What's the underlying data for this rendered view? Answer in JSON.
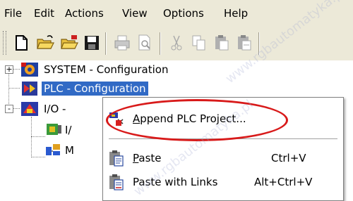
{
  "menubar": {
    "items": [
      "File",
      "Edit",
      "Actions",
      "View",
      "Options",
      "Help"
    ]
  },
  "toolbar": {
    "buttons": [
      "new-file-icon",
      "open-folder-icon",
      "open-recent-icon",
      "save-icon",
      "print-icon",
      "print-preview-icon",
      "cut-icon",
      "copy-icon",
      "paste-icon",
      "paste-links-icon"
    ]
  },
  "tree": {
    "nodes": [
      {
        "label": "SYSTEM - Configuration",
        "expander": "+"
      },
      {
        "label": "PLC - Configuration",
        "selected": true
      },
      {
        "label": "I/O - ",
        "expander": "-"
      },
      {
        "label": "I/"
      },
      {
        "label": "M"
      }
    ]
  },
  "context_menu": {
    "items": [
      {
        "label": "Append PLC Project...",
        "mnemonic": "A",
        "shortcut": ""
      },
      {
        "label": "Paste",
        "mnemonic": "P",
        "shortcut": "Ctrl+V"
      },
      {
        "label": "Paste with Links",
        "shortcut": "Alt+Ctrl+V"
      }
    ]
  },
  "annotation": {
    "color": "#d81a1a"
  },
  "colors": {
    "chrome": "#ece9d8",
    "selection": "#316ac5"
  },
  "watermark": "www.rgbautomatyka.pl"
}
